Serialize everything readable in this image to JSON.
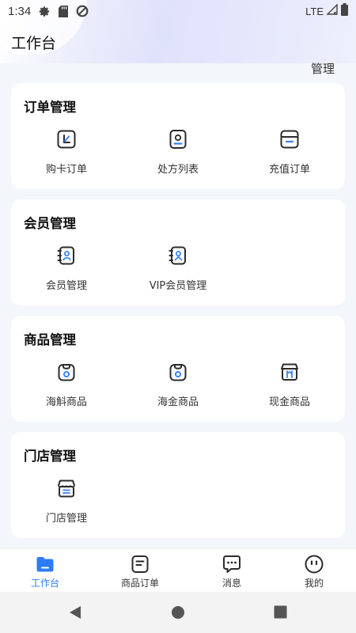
{
  "status": {
    "time": "1:34",
    "network": "LTE"
  },
  "header": {
    "title": "工作台",
    "manage": "管理"
  },
  "colors": {
    "accent": "#2d7cf6",
    "icon_dark": "#2b2b2b",
    "icon_blue": "#3a84f7"
  },
  "sections": [
    {
      "title": "订单管理",
      "items": [
        {
          "label": "购卡订单",
          "icon": "card-order-icon"
        },
        {
          "label": "处方列表",
          "icon": "prescription-list-icon"
        },
        {
          "label": "充值订单",
          "icon": "recharge-order-icon"
        }
      ]
    },
    {
      "title": "会员管理",
      "items": [
        {
          "label": "会员管理",
          "icon": "member-book-icon"
        },
        {
          "label": "VIP会员管理",
          "icon": "vip-member-book-icon"
        }
      ]
    },
    {
      "title": "商品管理",
      "items": [
        {
          "label": "海斛商品",
          "icon": "product-bag-icon"
        },
        {
          "label": "海金商品",
          "icon": "product-bag-icon"
        },
        {
          "label": "现金商品",
          "icon": "shop-gift-icon"
        }
      ]
    },
    {
      "title": "门店管理",
      "items": [
        {
          "label": "门店管理",
          "icon": "store-icon"
        }
      ]
    }
  ],
  "tabs": [
    {
      "label": "工作台",
      "icon": "folder-icon",
      "active": true
    },
    {
      "label": "商品订单",
      "icon": "order-note-icon",
      "active": false
    },
    {
      "label": "消息",
      "icon": "message-icon",
      "active": false
    },
    {
      "label": "我的",
      "icon": "profile-face-icon",
      "active": false
    }
  ]
}
